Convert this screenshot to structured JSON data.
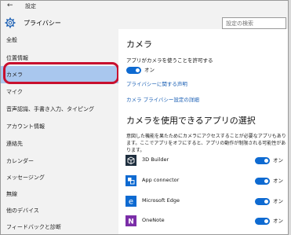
{
  "window": {
    "back_glyph": "←",
    "title": "設定"
  },
  "header": {
    "title": "プライバシー",
    "search_placeholder": "設定の検索"
  },
  "sidebar": {
    "items": [
      {
        "label": "全般"
      },
      {
        "label": "位置情報"
      },
      {
        "label": "カメラ"
      },
      {
        "label": "マイク"
      },
      {
        "label": "音声認識、手書き入力、タイピング"
      },
      {
        "label": "アカウント情報"
      },
      {
        "label": "連絡先"
      },
      {
        "label": "カレンダー"
      },
      {
        "label": "メッセージング"
      },
      {
        "label": "無線"
      },
      {
        "label": "他のデバイス"
      },
      {
        "label": "フィードバックと診断"
      }
    ],
    "selected_index": 2
  },
  "main": {
    "title": "カメラ",
    "allow_label": "アプリがカメラを使うことを許可する",
    "allow_state": "オン",
    "privacy_link": "プライバシーに関する声明",
    "camera_settings_link": "カメラ プライバシー設定の詳細",
    "apps_heading": "カメラを使用できるアプリの選択",
    "apps_description": "意図した機能を果たためにカメラにアクセスすることが必要なアプリもあります。ここでアプリをオフにすると、アプリの動作が制限される可能性があります。",
    "apps": [
      {
        "name": "3D Builder",
        "state": "オン",
        "icon": "3d-builder-icon"
      },
      {
        "name": "App connector",
        "state": "オン",
        "icon": "app-connector-icon"
      },
      {
        "name": "Microsoft Edge",
        "state": "オン",
        "icon": "edge-icon"
      },
      {
        "name": "OneNote",
        "state": "オン",
        "icon": "onenote-icon"
      }
    ]
  },
  "colors": {
    "accent": "#0e6ad1",
    "selected": "#a9c7ee",
    "link": "#1a5fb4",
    "highlight_ring": "#c8102e"
  }
}
